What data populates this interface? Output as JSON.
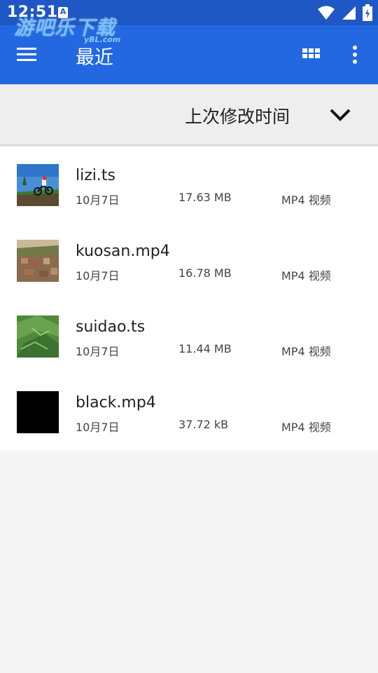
{
  "status_bar": {
    "time": "12:51",
    "notification_letter": "A",
    "icons": [
      "wifi-icon",
      "signal-icon",
      "battery-icon"
    ]
  },
  "watermark": {
    "text": "游吧乐下载",
    "sub": "yBL.com"
  },
  "app_bar": {
    "title": "最近",
    "icons": [
      "menu-icon",
      "grid-view-icon",
      "more-vert-icon"
    ],
    "color": "#2368e0",
    "status_color": "#1f57c4"
  },
  "sort": {
    "label": "上次修改时间",
    "icon": "chevron-down-icon"
  },
  "files": [
    {
      "name": "lizi.ts",
      "date": "10月7日",
      "size": "17.63 MB",
      "type": "MP4 视频",
      "thumb": "motocross-thumbnail"
    },
    {
      "name": "kuosan.mp4",
      "date": "10月7日",
      "size": "16.78 MB",
      "type": "MP4 视频",
      "thumb": "town-aerial-thumbnail"
    },
    {
      "name": "suidao.ts",
      "date": "10月7日",
      "size": "11.44 MB",
      "type": "MP4 视频",
      "thumb": "terrain-thumbnail"
    },
    {
      "name": "black.mp4",
      "date": "10月7日",
      "size": "37.72 kB",
      "type": "MP4 视频",
      "thumb": "black-thumbnail"
    }
  ]
}
